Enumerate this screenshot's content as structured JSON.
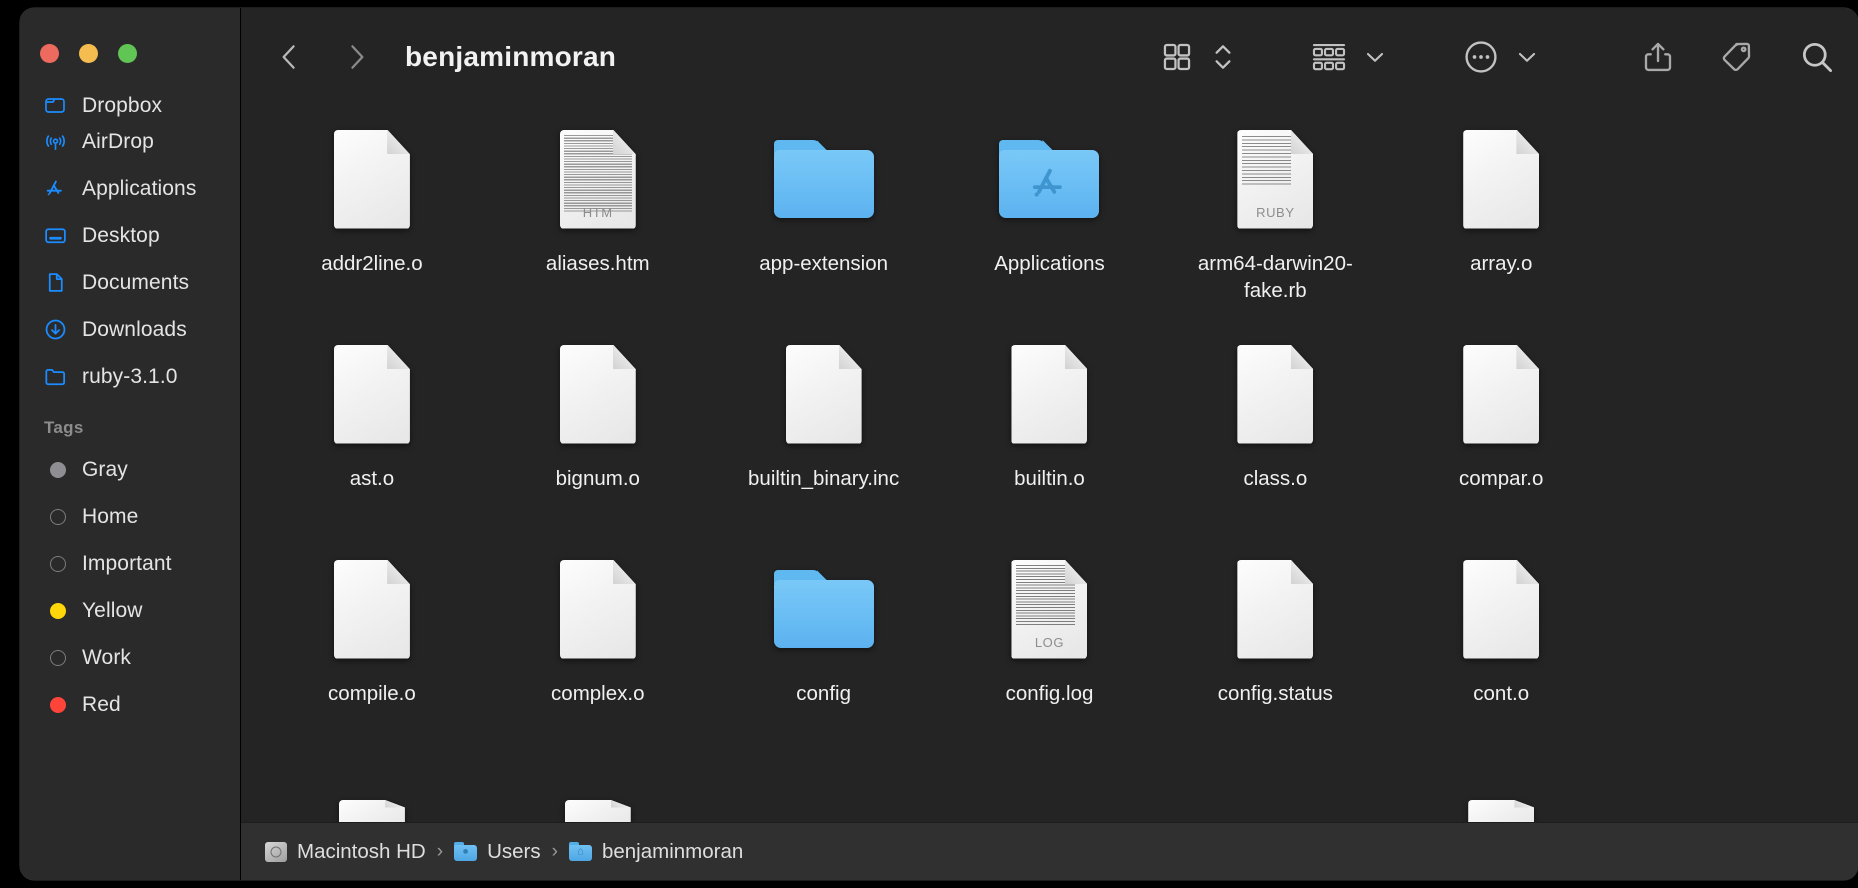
{
  "window": {
    "traffic_lights": [
      {
        "name": "close",
        "color": "#ed6a5e"
      },
      {
        "name": "minimize",
        "color": "#f5bd4f"
      },
      {
        "name": "maximize",
        "color": "#61c555"
      }
    ]
  },
  "toolbar": {
    "back_label": "‹",
    "forward_label": "›",
    "title": "benjaminmoran",
    "icons": [
      {
        "name": "icon-view-icon",
        "label": "Icon View"
      },
      {
        "name": "view-stepper-icon",
        "label": "View Options"
      },
      {
        "name": "group-by-icon",
        "label": "Group By"
      },
      {
        "name": "group-chevron-icon",
        "label": "Group Menu"
      },
      {
        "name": "more-actions-icon",
        "label": "More"
      },
      {
        "name": "more-chevron-icon",
        "label": "More Menu"
      },
      {
        "name": "share-icon",
        "label": "Share"
      },
      {
        "name": "tag-icon",
        "label": "Tags"
      },
      {
        "name": "search-icon",
        "label": "Search"
      }
    ]
  },
  "sidebar": {
    "favorites": [
      {
        "label": "Dropbox",
        "icon": "dropbox-folder-icon",
        "clipped": true
      },
      {
        "label": "AirDrop",
        "icon": "airdrop-icon",
        "clipped": false
      },
      {
        "label": "Applications",
        "icon": "applications-icon",
        "clipped": false
      },
      {
        "label": "Desktop",
        "icon": "desktop-icon",
        "clipped": false
      },
      {
        "label": "Documents",
        "icon": "documents-icon",
        "clipped": false
      },
      {
        "label": "Downloads",
        "icon": "downloads-icon",
        "clipped": false
      },
      {
        "label": "ruby-3.1.0",
        "icon": "folder-icon",
        "clipped": false
      }
    ],
    "tags_header": "Tags",
    "tags": [
      {
        "label": "Gray",
        "color": "#8e8e93",
        "filled": true
      },
      {
        "label": "Home",
        "color": "",
        "filled": false
      },
      {
        "label": "Important",
        "color": "",
        "filled": false
      },
      {
        "label": "Yellow",
        "color": "#ffd60a",
        "filled": true
      },
      {
        "label": "Work",
        "color": "",
        "filled": false
      },
      {
        "label": "Red",
        "color": "#ff453a",
        "filled": true
      }
    ]
  },
  "files": [
    {
      "name": "addr2line.o",
      "type": "document",
      "badge": ""
    },
    {
      "name": "aliases.htm",
      "type": "document-preview",
      "badge": "HTM"
    },
    {
      "name": "app-extension",
      "type": "folder",
      "badge": ""
    },
    {
      "name": "Applications",
      "type": "folder-app",
      "badge": ""
    },
    {
      "name": "arm64-darwin20-fake.rb",
      "type": "document-code",
      "badge": "RUBY"
    },
    {
      "name": "array.o",
      "type": "document",
      "badge": ""
    },
    {
      "name": "ast.o",
      "type": "document",
      "badge": ""
    },
    {
      "name": "bignum.o",
      "type": "document",
      "badge": ""
    },
    {
      "name": "builtin_binary.inc",
      "type": "document",
      "badge": ""
    },
    {
      "name": "builtin.o",
      "type": "document",
      "badge": ""
    },
    {
      "name": "class.o",
      "type": "document",
      "badge": ""
    },
    {
      "name": "compar.o",
      "type": "document",
      "badge": ""
    },
    {
      "name": "compile.o",
      "type": "document",
      "badge": ""
    },
    {
      "name": "complex.o",
      "type": "document",
      "badge": ""
    },
    {
      "name": "config",
      "type": "folder",
      "badge": ""
    },
    {
      "name": "config.log",
      "type": "document-log",
      "badge": "LOG"
    },
    {
      "name": "config.status",
      "type": "document",
      "badge": ""
    },
    {
      "name": "cont.o",
      "type": "document",
      "badge": ""
    }
  ],
  "pathbar": {
    "crumbs": [
      {
        "label": "Macintosh HD",
        "icon": "hard-drive-icon"
      },
      {
        "label": "Users",
        "icon": "users-folder-icon"
      },
      {
        "label": "benjaminmoran",
        "icon": "home-folder-icon"
      }
    ],
    "separator": "›"
  },
  "colors": {
    "window_bg": "#242424",
    "sidebar_bg": "#2a2a2a",
    "pathbar_bg": "#303030",
    "accent": "#1a8cff",
    "folder_blue": "#69bdf4",
    "text": "#f0f0f0"
  }
}
